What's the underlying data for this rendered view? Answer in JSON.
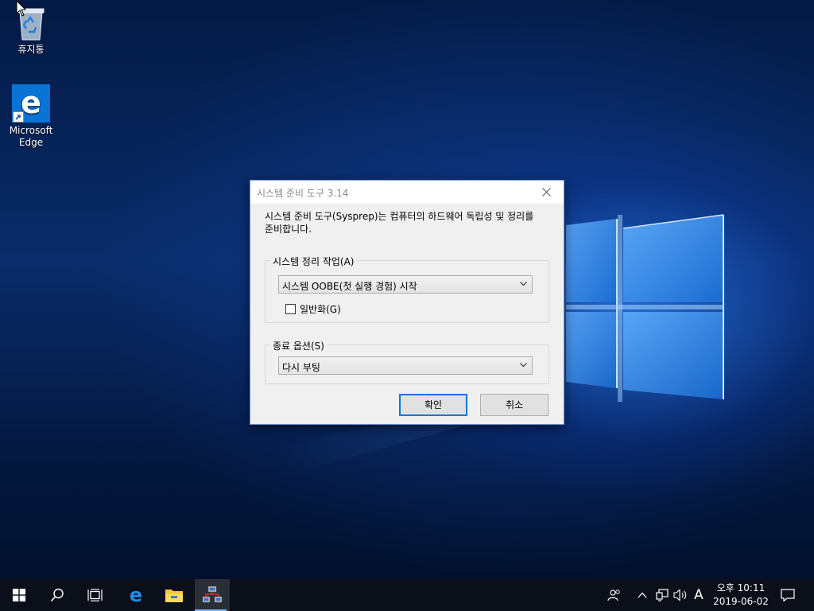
{
  "desktop": {
    "icons": [
      {
        "label": "휴지통",
        "icon": "recycle-bin-icon"
      },
      {
        "label_line1": "Microsoft",
        "label_line2": "Edge",
        "icon": "edge-icon"
      }
    ]
  },
  "dialog": {
    "title": "시스템 준비 도구 3.14",
    "description_line1": "시스템 준비 도구(Sysprep)는 컴퓨터의 하드웨어 독립성 및 정리를",
    "description_line2": "준비합니다.",
    "cleanup_group": {
      "label": "시스템 정리 작업(A)",
      "selected": "시스템 OOBE(첫 실행 경험) 시작",
      "generalize_label": "일반화(G)",
      "generalize_checked": false
    },
    "shutdown_group": {
      "label": "종료 옵션(S)",
      "selected": "다시 부팅"
    },
    "ok_label": "확인",
    "cancel_label": "취소"
  },
  "taskbar": {
    "apps": [
      "start-icon",
      "search-icon",
      "task-view-icon",
      "edge-icon",
      "file-explorer-icon",
      "network-setup-icon"
    ],
    "ime_indicator": "A",
    "clock": {
      "time": "오후 10:11",
      "date": "2019-06-02"
    }
  },
  "colors": {
    "accent": "#0078d7",
    "taskbar": "#0b0f19",
    "dialog_bg": "#f0f0f0"
  }
}
